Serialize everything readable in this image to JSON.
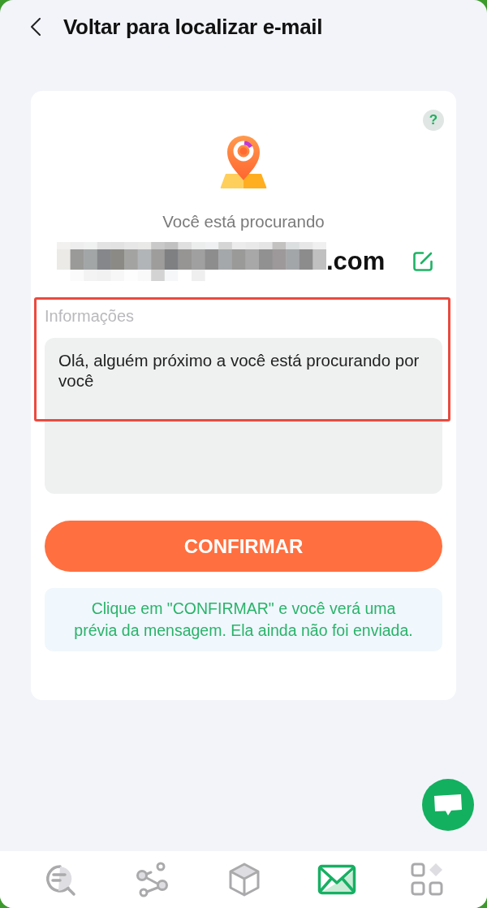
{
  "header": {
    "title": "Voltar para localizar e-mail"
  },
  "card": {
    "help": "?",
    "prompt": "Você está procurando",
    "email": {
      "visible_text": ".com",
      "redacted": true
    },
    "message": {
      "label": "Informações",
      "value": "Olá, alguém próximo a você está procurando por você",
      "highlighted": true
    },
    "confirm_button": "CONFIRMAR",
    "note": "Clique em \"CONFIRMAR\" e você verá uma prévia da mensagem. Ela ainda não foi enviada."
  },
  "bottom_nav": [
    {
      "selected": false
    },
    {
      "selected": false
    },
    {
      "selected": false
    },
    {
      "selected": true
    },
    {
      "selected": false
    }
  ]
}
